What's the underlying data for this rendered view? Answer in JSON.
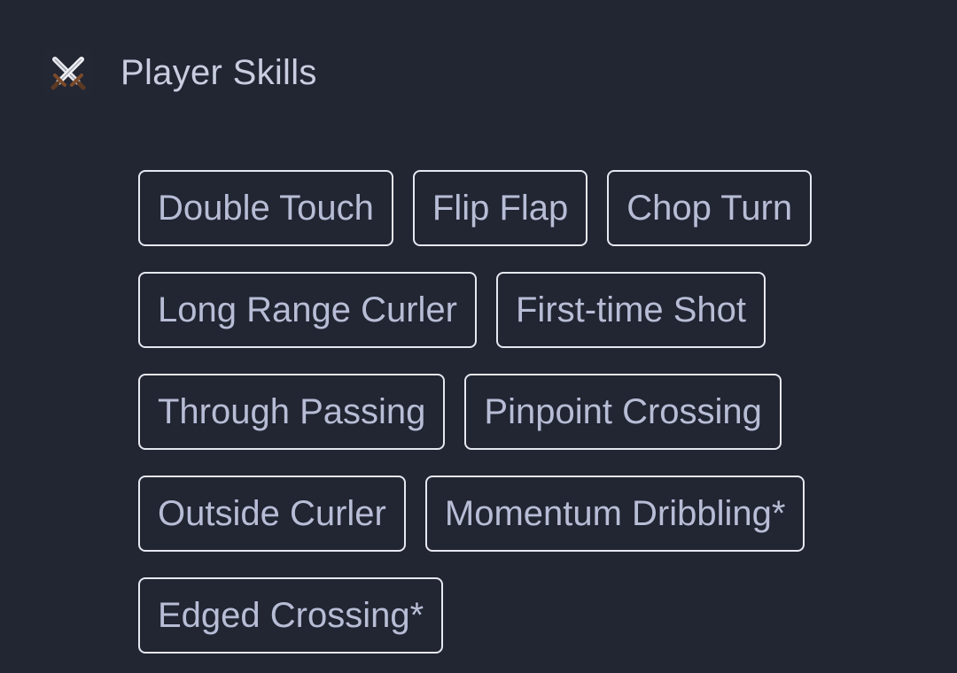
{
  "header": {
    "icon": "crossed-swords-icon",
    "title": "Player Skills"
  },
  "skills": [
    "Double Touch",
    "Flip Flap",
    "Chop Turn",
    "Long Range Curler",
    "First-time Shot",
    "Through Passing",
    "Pinpoint Crossing",
    "Outside Curler",
    "Momentum Dribbling*",
    "Edged Crossing*"
  ],
  "colors": {
    "background": "#222532",
    "chip_border": "#e6e8f0",
    "chip_text": "#b8bdd6",
    "title_text": "#c9cde0"
  }
}
